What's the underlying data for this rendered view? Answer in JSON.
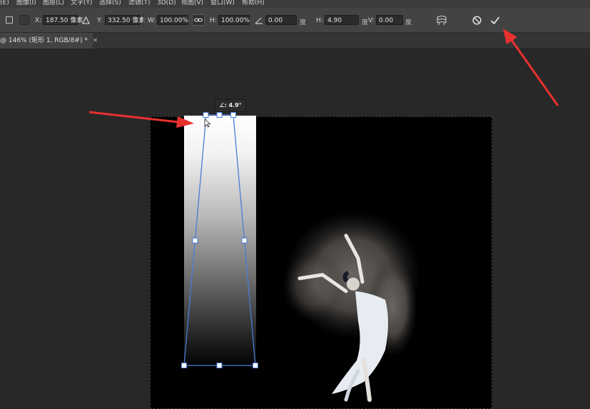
{
  "menu": {
    "items": [
      "(E)",
      "图像(I)",
      "图层(L)",
      "文字(Y)",
      "选择(S)",
      "滤镜(T)",
      "3D(D)",
      "视图(V)",
      "窗口(W)",
      "帮助(H)"
    ]
  },
  "options": {
    "x_label": "X:",
    "x_value": "187.50 像素",
    "y_label": "Y:",
    "y_value": "332.50 像素",
    "w_label": "W:",
    "w_value": "100.00%",
    "h_label": "H:",
    "h_value": "100.00%",
    "rot_value": "0.00",
    "rot_unit": "度",
    "hskew_label": "H:",
    "hskew_value": "4.90",
    "hskew_unit": "度",
    "vskew_label": "V:",
    "vskew_value": "0.00",
    "vskew_unit": "度"
  },
  "document_tab": {
    "title": "@ 146% (矩形 1, RGB/8#) *",
    "close": "×"
  },
  "canvas": {
    "angle_badge": "∠: 4.9°"
  },
  "icons": {
    "reference_point": "reference-point-icon",
    "delta": "delta-icon",
    "link": "link-icon",
    "angle": "angle-icon",
    "warp": "warp-icon",
    "cancel": "cancel-icon",
    "commit": "checkmark-icon"
  },
  "colors": {
    "annotation_arrow": "#e8312f",
    "handle_line": "#4a7bd6"
  }
}
